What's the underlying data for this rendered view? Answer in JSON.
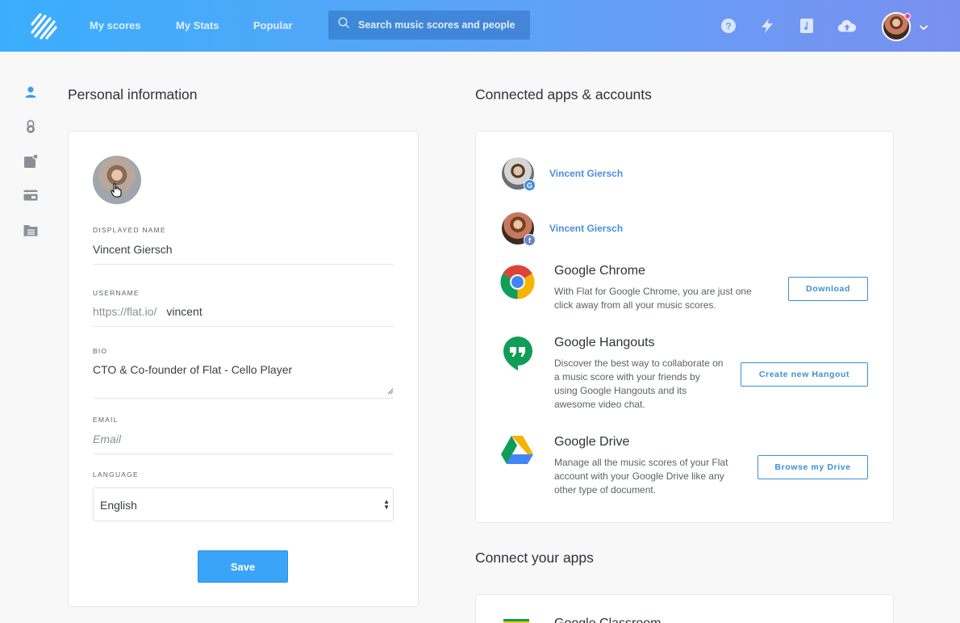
{
  "header": {
    "nav": [
      "My scores",
      "My Stats",
      "Popular"
    ],
    "search_placeholder": "Search music scores and people",
    "accent_start": "#3aaefc",
    "accent_end": "#7a90f0"
  },
  "sidebar": {
    "icons": [
      "user-icon",
      "lock-icon",
      "notification-icon",
      "credit-card-icon",
      "folder-icon"
    ]
  },
  "personal": {
    "heading": "Personal information",
    "displayed_name_label": "DISPLAYED NAME",
    "displayed_name": "Vincent Giersch",
    "username_label": "USERNAME",
    "username_prefix": "https://flat.io/",
    "username": "vincent",
    "bio_label": "BIO",
    "bio": "CTO & Co-founder of Flat - Cello Player",
    "email_label": "EMAIL",
    "email_placeholder": "Email",
    "language_label": "LANGUAGE",
    "language": "English",
    "save_label": "Save"
  },
  "connected": {
    "heading": "Connected apps & accounts",
    "accounts": [
      {
        "name": "Vincent Giersch",
        "provider": "G"
      },
      {
        "name": "Vincent Giersch",
        "provider": "f"
      }
    ],
    "apps": [
      {
        "title": "Google Chrome",
        "desc": "With Flat for Google Chrome, you are just one click away from all your music scores.",
        "button": "Download"
      },
      {
        "title": "Google Hangouts",
        "desc": "Discover the best way to collaborate on a music score with your friends by using Google Hangouts and its awesome video chat.",
        "button": "Create new Hangout"
      },
      {
        "title": "Google Drive",
        "desc": "Manage all the music scores of your Flat account with your Google Drive like any other type of document.",
        "button": "Browse my Drive"
      }
    ]
  },
  "connect_apps": {
    "heading": "Connect your apps",
    "first_app": "Google Classroom"
  }
}
